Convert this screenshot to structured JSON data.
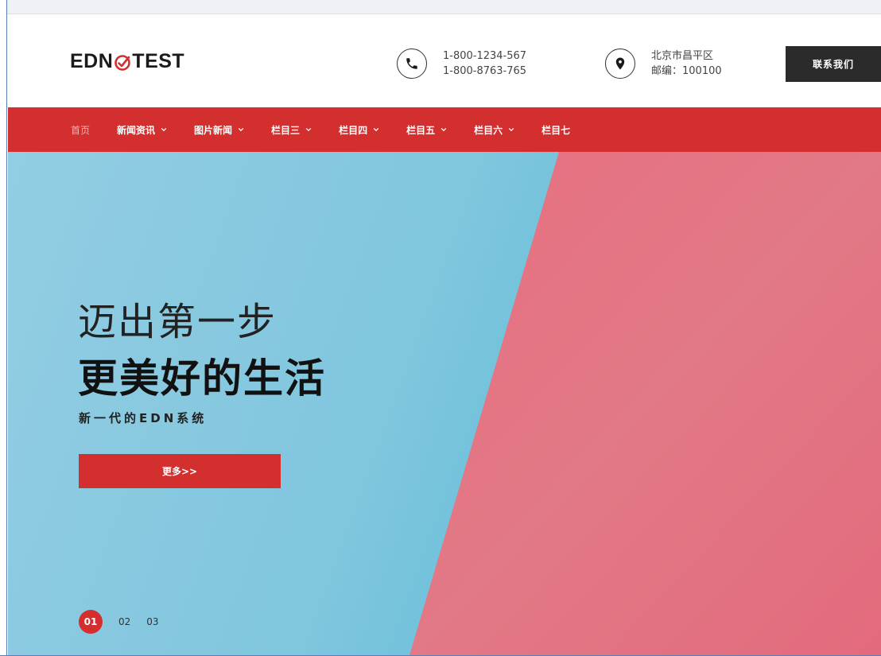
{
  "header": {
    "logo_text_left": "EDN",
    "logo_text_right": "TEST",
    "phone_lines": [
      "1-800-1234-567",
      "1-800-8763-765"
    ],
    "address_lines": [
      "北京市昌平区",
      "邮编：100100"
    ],
    "cta_label": "联系我们"
  },
  "nav": {
    "items": [
      {
        "label": "首页",
        "has_dropdown": false
      },
      {
        "label": "新闻资讯",
        "has_dropdown": true
      },
      {
        "label": "图片新闻",
        "has_dropdown": true
      },
      {
        "label": "栏目三",
        "has_dropdown": true
      },
      {
        "label": "栏目四",
        "has_dropdown": true
      },
      {
        "label": "栏目五",
        "has_dropdown": true
      },
      {
        "label": "栏目六",
        "has_dropdown": true
      },
      {
        "label": "栏目七",
        "has_dropdown": false
      }
    ]
  },
  "hero": {
    "title_line1": "迈出第一步",
    "title_line2": "更美好的生活",
    "subtitle": "新一代的EDN系统",
    "button_label": "更多>>",
    "slides": [
      "01",
      "02",
      "03"
    ]
  },
  "colors": {
    "accent": "#d32f2f",
    "dark": "#2b2b2b",
    "hero_blue": "#7fc6de",
    "hero_pink": "#e4707f"
  },
  "icons": {
    "phone": "phone-icon",
    "location": "location-pin-icon",
    "chevron": "chevron-down-icon"
  }
}
